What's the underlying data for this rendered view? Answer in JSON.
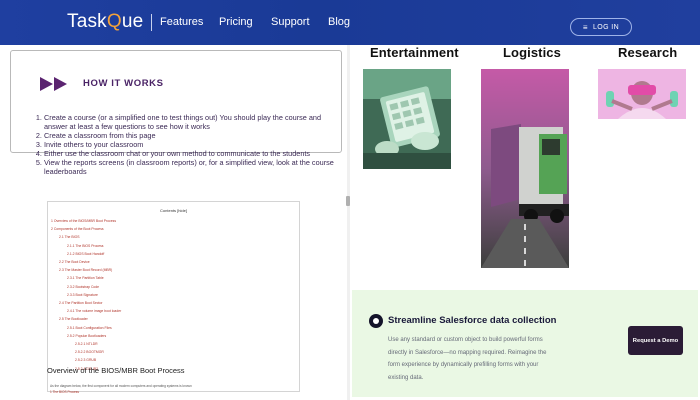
{
  "header": {
    "logo_text_left": "Task",
    "logo_text_q": "Q",
    "logo_text_right": "ue",
    "nav": [
      "Features",
      "Pricing",
      "Support",
      "Blog"
    ],
    "login_label": "LOG IN"
  },
  "how_it_works": {
    "title": "HOW IT WORKS",
    "steps": [
      "Create a course (or a simplified one to test things out)   You should play the course and answer at least a few questions to see how it works",
      "Create a classroom from this page",
      "Invite others to your classroom",
      "Either use the classroom chat or your own method to communicate to the students",
      "View the reports screens (in classroom reports) or, for a simplified view, look at the course leaderboards"
    ]
  },
  "document": {
    "contents_header": "Contents [hide]",
    "toc": [
      "1 Overview of the BIOS/MBR Boot Process",
      "2 Components of the Boot Process",
      "2.1 The BIOS",
      "2.1.1 The BIOS Process",
      "2.1.2 BIOS Boot Handoff",
      "2.2 The Boot Device",
      "2.3 The Master Boot Record (MBR)",
      "2.3.1 The Partition Table",
      "2.3.2 Bootstrap Code",
      "2.3.3 Boot Signature",
      "2.4 The Partition Boot Sector",
      "2.4.1 The volume image boot loader",
      "2.5 The Bootloader",
      "2.5.1 Boot Configuration Files",
      "2.5.2 Popular Bootloaders",
      "2.5.2.1 NTLDR",
      "2.5.2.2 BOOTMGR",
      "2.5.2.3 GRUB",
      "2.5.2.4 GRUB2"
    ],
    "heading": "Overview of the BIOS/MBR Boot Process",
    "sub_line1": "As the diagram below, the first component for all modern computers and operating systems is known",
    "sub_line2": "1 The BIOS Process"
  },
  "categories": [
    "Entertainment",
    "Logistics",
    "Research"
  ],
  "promo": {
    "title": "Streamline Salesforce data collection",
    "body": "Use any standard or custom object to build powerful forms directly in Salesforce—no mapping required. Reimagine the form experience by dynamically prefilling forms with your existing data.",
    "button_label": "Request a Demo"
  }
}
